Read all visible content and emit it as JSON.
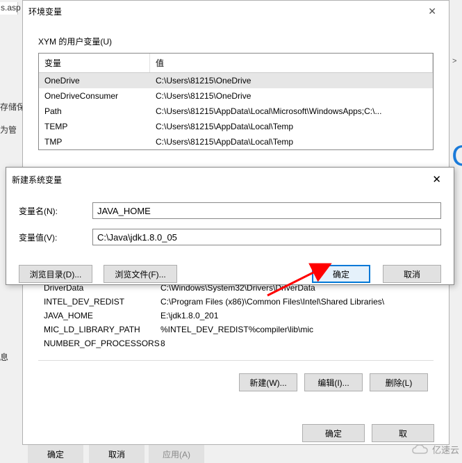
{
  "bg": {
    "asp": "s.asp",
    "radio1": "存储保",
    "label1": "为管",
    "label2": "息",
    "arrow_right": ">",
    "big_blue": "C",
    "bottom1": "确定",
    "bottom2": "取消",
    "bottom3": "应用(A)"
  },
  "env_dialog": {
    "title": "环境变量",
    "user_section_label": "XYM 的用户变量(U)",
    "col_name": "变量",
    "col_value": "值",
    "user_vars": [
      {
        "n": "OneDrive",
        "v": "C:\\Users\\81215\\OneDrive"
      },
      {
        "n": "OneDriveConsumer",
        "v": "C:\\Users\\81215\\OneDrive"
      },
      {
        "n": "Path",
        "v": "C:\\Users\\81215\\AppData\\Local\\Microsoft\\WindowsApps;C:\\..."
      },
      {
        "n": "TEMP",
        "v": "C:\\Users\\81215\\AppData\\Local\\Temp"
      },
      {
        "n": "TMP",
        "v": "C:\\Users\\81215\\AppData\\Local\\Temp"
      }
    ],
    "sys_vars": [
      {
        "n": "DriverData",
        "v": "C:\\Windows\\System32\\Drivers\\DriverData"
      },
      {
        "n": "INTEL_DEV_REDIST",
        "v": "C:\\Program Files (x86)\\Common Files\\Intel\\Shared Libraries\\"
      },
      {
        "n": "JAVA_HOME",
        "v": "E:\\jdk1.8.0_201"
      },
      {
        "n": "MIC_LD_LIBRARY_PATH",
        "v": "%INTEL_DEV_REDIST%compiler\\lib\\mic"
      },
      {
        "n": "NUMBER_OF_PROCESSORS",
        "v": "8"
      }
    ],
    "btn_new": "新建(W)...",
    "btn_edit": "编辑(I)...",
    "btn_delete": "删除(L)",
    "btn_ok": "确定",
    "btn_cancel": "取"
  },
  "newvar": {
    "title": "新建系统变量",
    "label_name": "变量名(N):",
    "label_value": "变量值(V):",
    "value_name": "JAVA_HOME",
    "value_val": "C:\\Java\\jdk1.8.0_05",
    "browse_dir": "浏览目录(D)...",
    "browse_file": "浏览文件(F)...",
    "ok": "确定",
    "cancel": "取消"
  },
  "watermark": "亿速云"
}
